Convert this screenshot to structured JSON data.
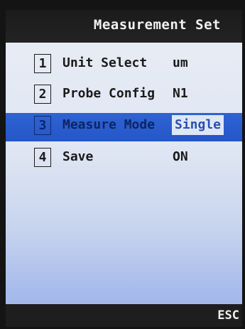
{
  "header": {
    "title": "Measurement Set"
  },
  "menu": {
    "items": [
      {
        "num": "1",
        "label": "Unit Select",
        "value": "um"
      },
      {
        "num": "2",
        "label": "Probe Config",
        "value": "N1"
      },
      {
        "num": "3",
        "label": "Measure Mode",
        "value": "Single"
      },
      {
        "num": "4",
        "label": "Save",
        "value": "ON"
      }
    ],
    "selected_index": 2
  },
  "footer": {
    "esc_label": "ESC"
  },
  "colors": {
    "selected_row": "#2456c8",
    "screen_background": "#dfe6f3",
    "title_bar": "#1b1b1b"
  }
}
